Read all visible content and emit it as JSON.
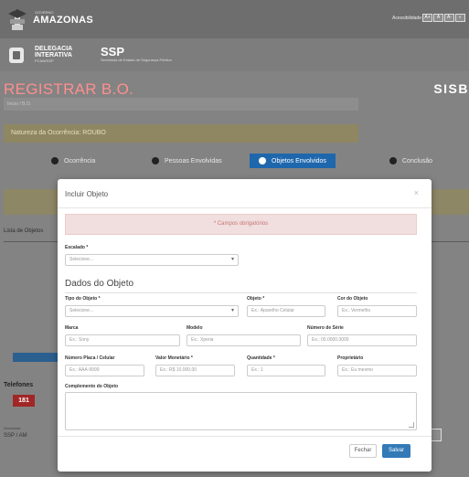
{
  "header": {
    "superscript": "GOVERNO",
    "state": "AMAZONAS",
    "accessibility_label": "Acessibilidade",
    "accessibility_buttons": [
      "A+",
      "A",
      "A-",
      "◐"
    ]
  },
  "brand": {
    "delegacia_line1": "DELEGACIA",
    "delegacia_line2": "INTERATIVA",
    "delegacia_sub": "PCAM/SSP",
    "ssp": "SSP",
    "ssp_sub": "Secretaria de Estado de Segurança Pública"
  },
  "page": {
    "title": "REGISTRAR B.O.",
    "system": "SISB",
    "breadcrumb": "Início / B.O.",
    "alert": "Natureza da Ocorrência: ROUBO",
    "steps": [
      {
        "label": "Ocorrência",
        "active": false
      },
      {
        "label": "Pessoas Envolvidas",
        "active": false
      },
      {
        "label": "Objetos Envolvidos",
        "active": true
      },
      {
        "label": "Conclusão",
        "active": false
      }
    ],
    "lista_label": "Lista de Objetos",
    "telefone_label": "Telefones",
    "telefone_badge": "181",
    "footer_small": "Secretaria",
    "footer_text": "SSP / AM"
  },
  "modal": {
    "title": "Incluir Objeto",
    "close": "×",
    "required_msg": "* Campos obrigatórios",
    "fields": {
      "escalado_label": "Escalado *",
      "escalado_value": "Selecione...",
      "section_title": "Dados do Objeto",
      "tipo_label": "Tipo do Objeto *",
      "tipo_value": "Selecione...",
      "objeto_label": "Objeto *",
      "objeto_placeholder": "Ex.: Aparelho Celular",
      "cor_label": "Cor do Objeto",
      "cor_placeholder": "Ex.: Vermelho",
      "marca_label": "Marca",
      "marca_placeholder": "Ex.: Sony",
      "modelo_label": "Modelo",
      "modelo_placeholder": "Ex.: Xperia",
      "serie_label": "Número de Série",
      "serie_placeholder": "Ex.: 00.0000.0000",
      "placa_label": "Número Placa / Celular",
      "placa_placeholder": "Ex.: AAA-9999",
      "valor_label": "Valor Monetário *",
      "valor_placeholder": "Ex.: R$ 10.000,00",
      "quantidade_label": "Quantidade *",
      "quantidade_placeholder": "Ex.: 1",
      "proprietario_label": "Proprietário",
      "proprietario_placeholder": "Ex.: Eu mesmo",
      "complemento_label": "Complemento do Objeto"
    },
    "buttons": {
      "close": "Fechar",
      "save": "Salvar"
    }
  }
}
